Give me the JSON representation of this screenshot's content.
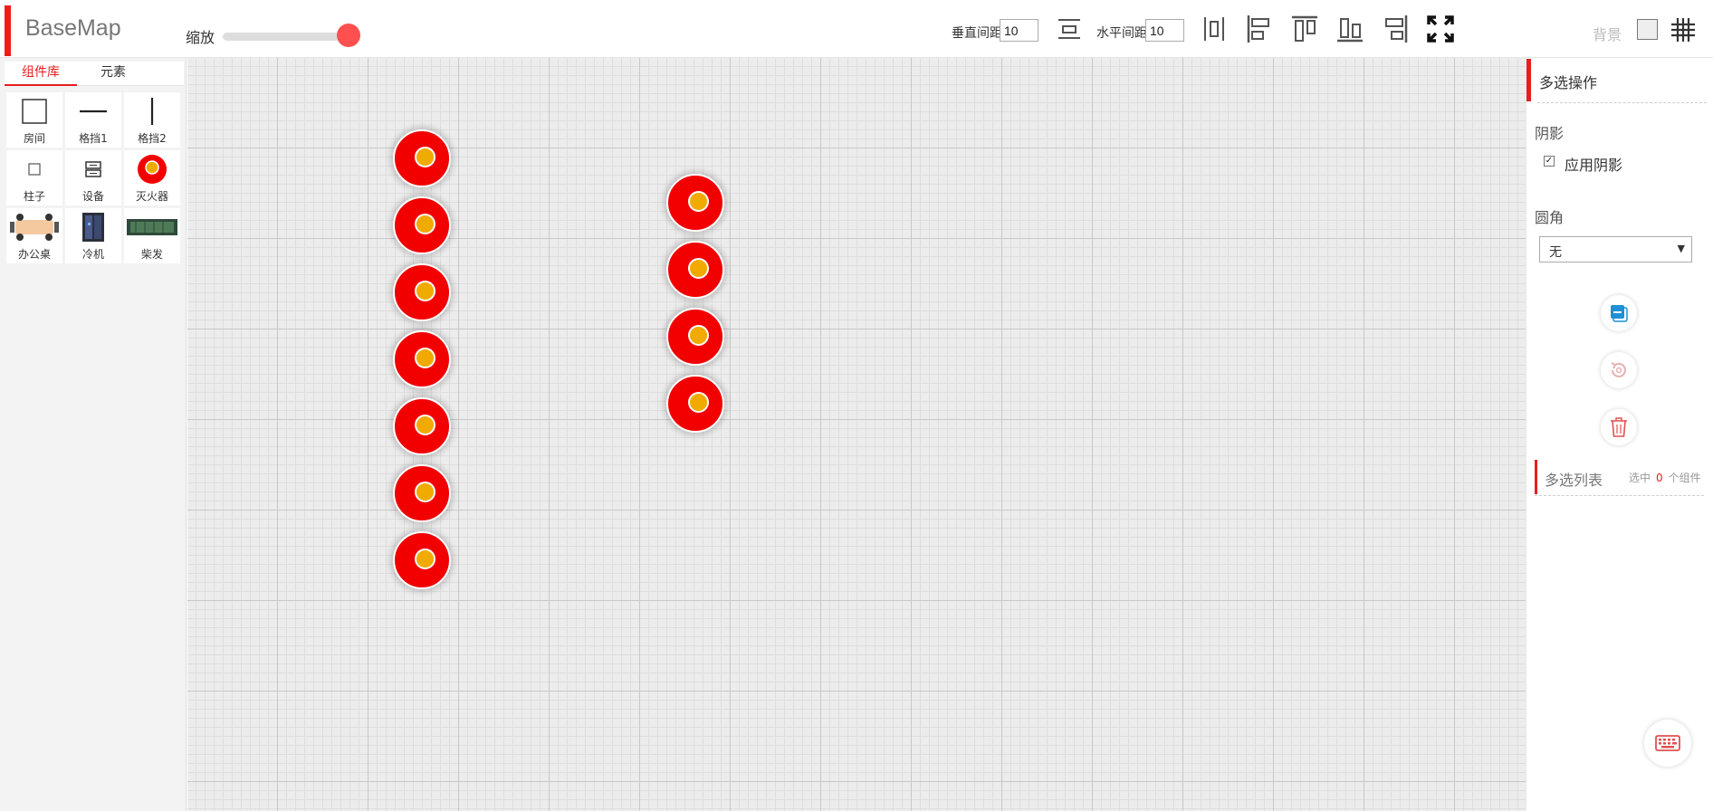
{
  "header": {
    "brand": "BaseMap",
    "zoom_label": "缩放",
    "zoom_level": 0.85,
    "vertical_spacing_label": "垂直间距:",
    "vertical_spacing_value": "10",
    "horizontal_spacing_label": "水平间距:",
    "horizontal_spacing_value": "10",
    "background_label": "背景",
    "toolbar_icons": [
      "vertical-spacing-icon",
      "horizontal-center-icon",
      "align-left-icon",
      "align-top-icon",
      "align-bottom-icon",
      "align-right-icon",
      "fullscreen-icon",
      "grid-icon"
    ]
  },
  "left_panel": {
    "tabs": [
      {
        "label": "组件库",
        "active": true
      },
      {
        "label": "元素",
        "active": false
      }
    ],
    "components": [
      {
        "label": "房间",
        "icon": "room-icon"
      },
      {
        "label": "格挡1",
        "icon": "partition-horizontal-icon"
      },
      {
        "label": "格挡2",
        "icon": "partition-vertical-icon"
      },
      {
        "label": "柱子",
        "icon": "pillar-icon"
      },
      {
        "label": "设备",
        "icon": "device-icon"
      },
      {
        "label": "灭火器",
        "icon": "fire-extinguisher-icon"
      },
      {
        "label": "办公桌",
        "icon": "office-desk-icon"
      },
      {
        "label": "冷机",
        "icon": "chiller-icon"
      },
      {
        "label": "柴发",
        "icon": "diesel-generator-icon"
      }
    ]
  },
  "canvas": {
    "extinguisher_count": 11
  },
  "right_panel": {
    "title": "多选操作",
    "shadow_heading": "阴影",
    "apply_shadow_label": "应用阴影",
    "apply_shadow_checked": true,
    "corner_heading": "圆角",
    "corner_value": "无",
    "action_icons": [
      "copy-icon",
      "rotate-icon",
      "delete-icon"
    ],
    "list_title": "多选列表",
    "selected_prefix": "选中",
    "selected_count": "0",
    "selected_suffix": "个组件",
    "keyboard_icon": "keyboard-icon"
  },
  "colors": {
    "accent": "#e61e1e",
    "extinguisher_red": "#f20000",
    "extinguisher_core": "#f1aa00"
  }
}
